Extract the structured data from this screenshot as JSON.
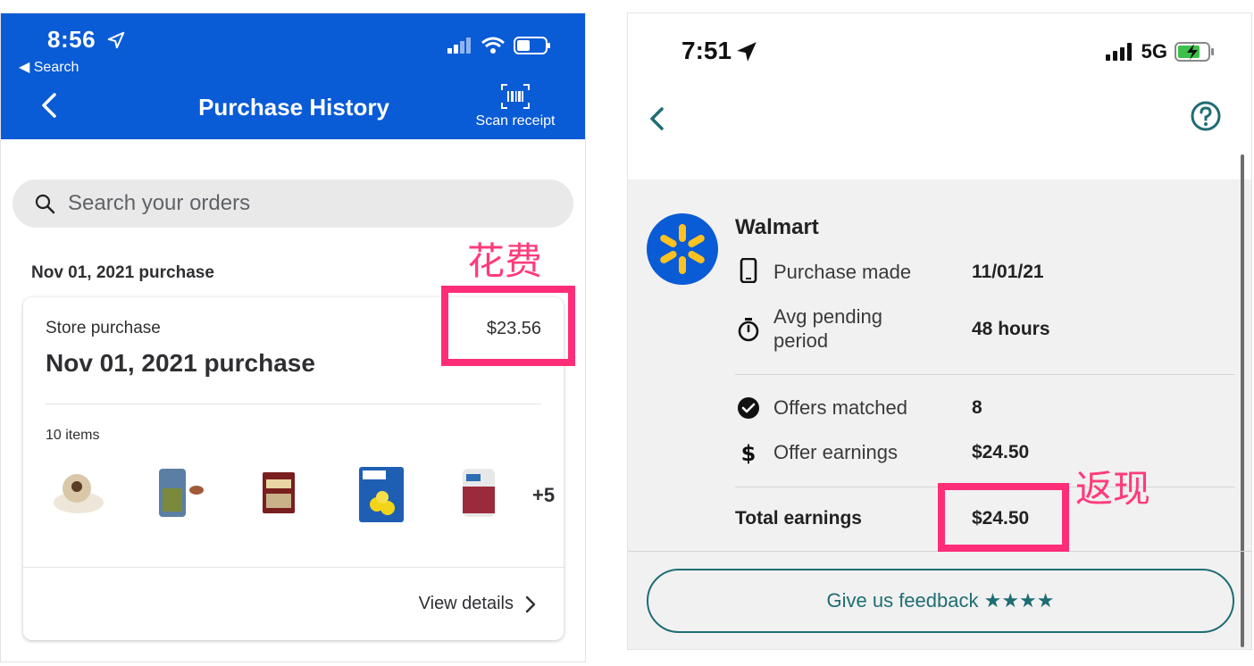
{
  "left": {
    "status": {
      "time": "8:56",
      "back_label": "◀ Search"
    },
    "header": {
      "title": "Purchase History",
      "scan_label": "Scan receipt"
    },
    "search": {
      "placeholder": "Search your orders"
    },
    "section_date": "Nov 01, 2021 purchase",
    "annotation": "花费",
    "order": {
      "type": "Store purchase",
      "title": "Nov 01, 2021 purchase",
      "price": "$23.56",
      "items_count": "10 items",
      "more": "+5",
      "view_details": "View details"
    },
    "colors": {
      "header_bg": "#0a5bd6",
      "annotation": "#ff2d78"
    }
  },
  "right": {
    "status": {
      "time": "7:51",
      "network": "5G"
    },
    "merchant": "Walmart",
    "rows": [
      {
        "icon": "phone-icon",
        "label": "Purchase made",
        "value": "11/01/21"
      },
      {
        "icon": "stopwatch-icon",
        "label": "Avg pending period",
        "value": "48 hours"
      },
      {
        "icon": "check-circle-icon",
        "label": "Offers matched",
        "value": "8"
      },
      {
        "icon": "dollar-icon",
        "label": "Offer earnings",
        "value": "$24.50"
      }
    ],
    "total": {
      "label": "Total earnings",
      "value": "$24.50"
    },
    "annotation": "返现",
    "feedback": "Give us feedback ★★★★",
    "colors": {
      "accent": "#1f6d74",
      "logo_bg": "#0a5bd6",
      "logo_spark": "#ffc220"
    }
  }
}
